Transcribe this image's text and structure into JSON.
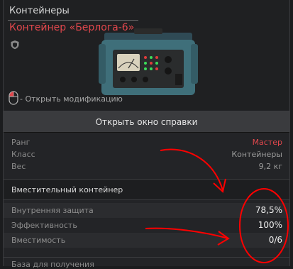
{
  "header": {
    "category": "Контейнеры",
    "title": "Контейнер «Берлога-6»",
    "modification_hint": "- Открыть модификацию"
  },
  "help_button": {
    "label": "Открыть окно справки"
  },
  "info_rows": [
    {
      "key": "Ранг",
      "value": "Мастер"
    },
    {
      "key": "Класс",
      "value": "Контейнеры"
    },
    {
      "key": "Вес",
      "value": "9,2 кг"
    }
  ],
  "section_title": "Вместительный контейнер",
  "stats": [
    {
      "key": "Внутренняя защита",
      "value": "78,5%"
    },
    {
      "key": "Эффективность",
      "value": "100%"
    },
    {
      "key": "Вместимость",
      "value": "0/6"
    }
  ],
  "footer": {
    "label": "База для получения"
  },
  "colors": {
    "accent_red": "#e0474c",
    "annotation_red": "#ff0000"
  },
  "icons": {
    "shield": "shield-icon",
    "mouse": "mouse-icon"
  }
}
